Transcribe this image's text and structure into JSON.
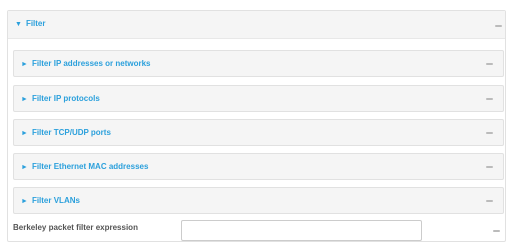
{
  "filter": {
    "title": "Filter",
    "expand_glyph": "▼",
    "collapse_icon": "minus-icon",
    "sections": [
      {
        "label": "Filter IP addresses or networks",
        "glyph": "►"
      },
      {
        "label": "Filter IP protocols",
        "glyph": "►"
      },
      {
        "label": "Filter TCP/UDP ports",
        "glyph": "►"
      },
      {
        "label": "Filter Ethernet MAC addresses",
        "glyph": "►"
      },
      {
        "label": "Filter VLANs",
        "glyph": "►"
      }
    ],
    "bpf": {
      "label": "Berkeley packet filter expression",
      "value": ""
    }
  },
  "colors": {
    "accent": "#2ba0dc",
    "panel_bg": "#f5f5f5",
    "border": "#e1e1e1",
    "label_text": "#555555"
  }
}
